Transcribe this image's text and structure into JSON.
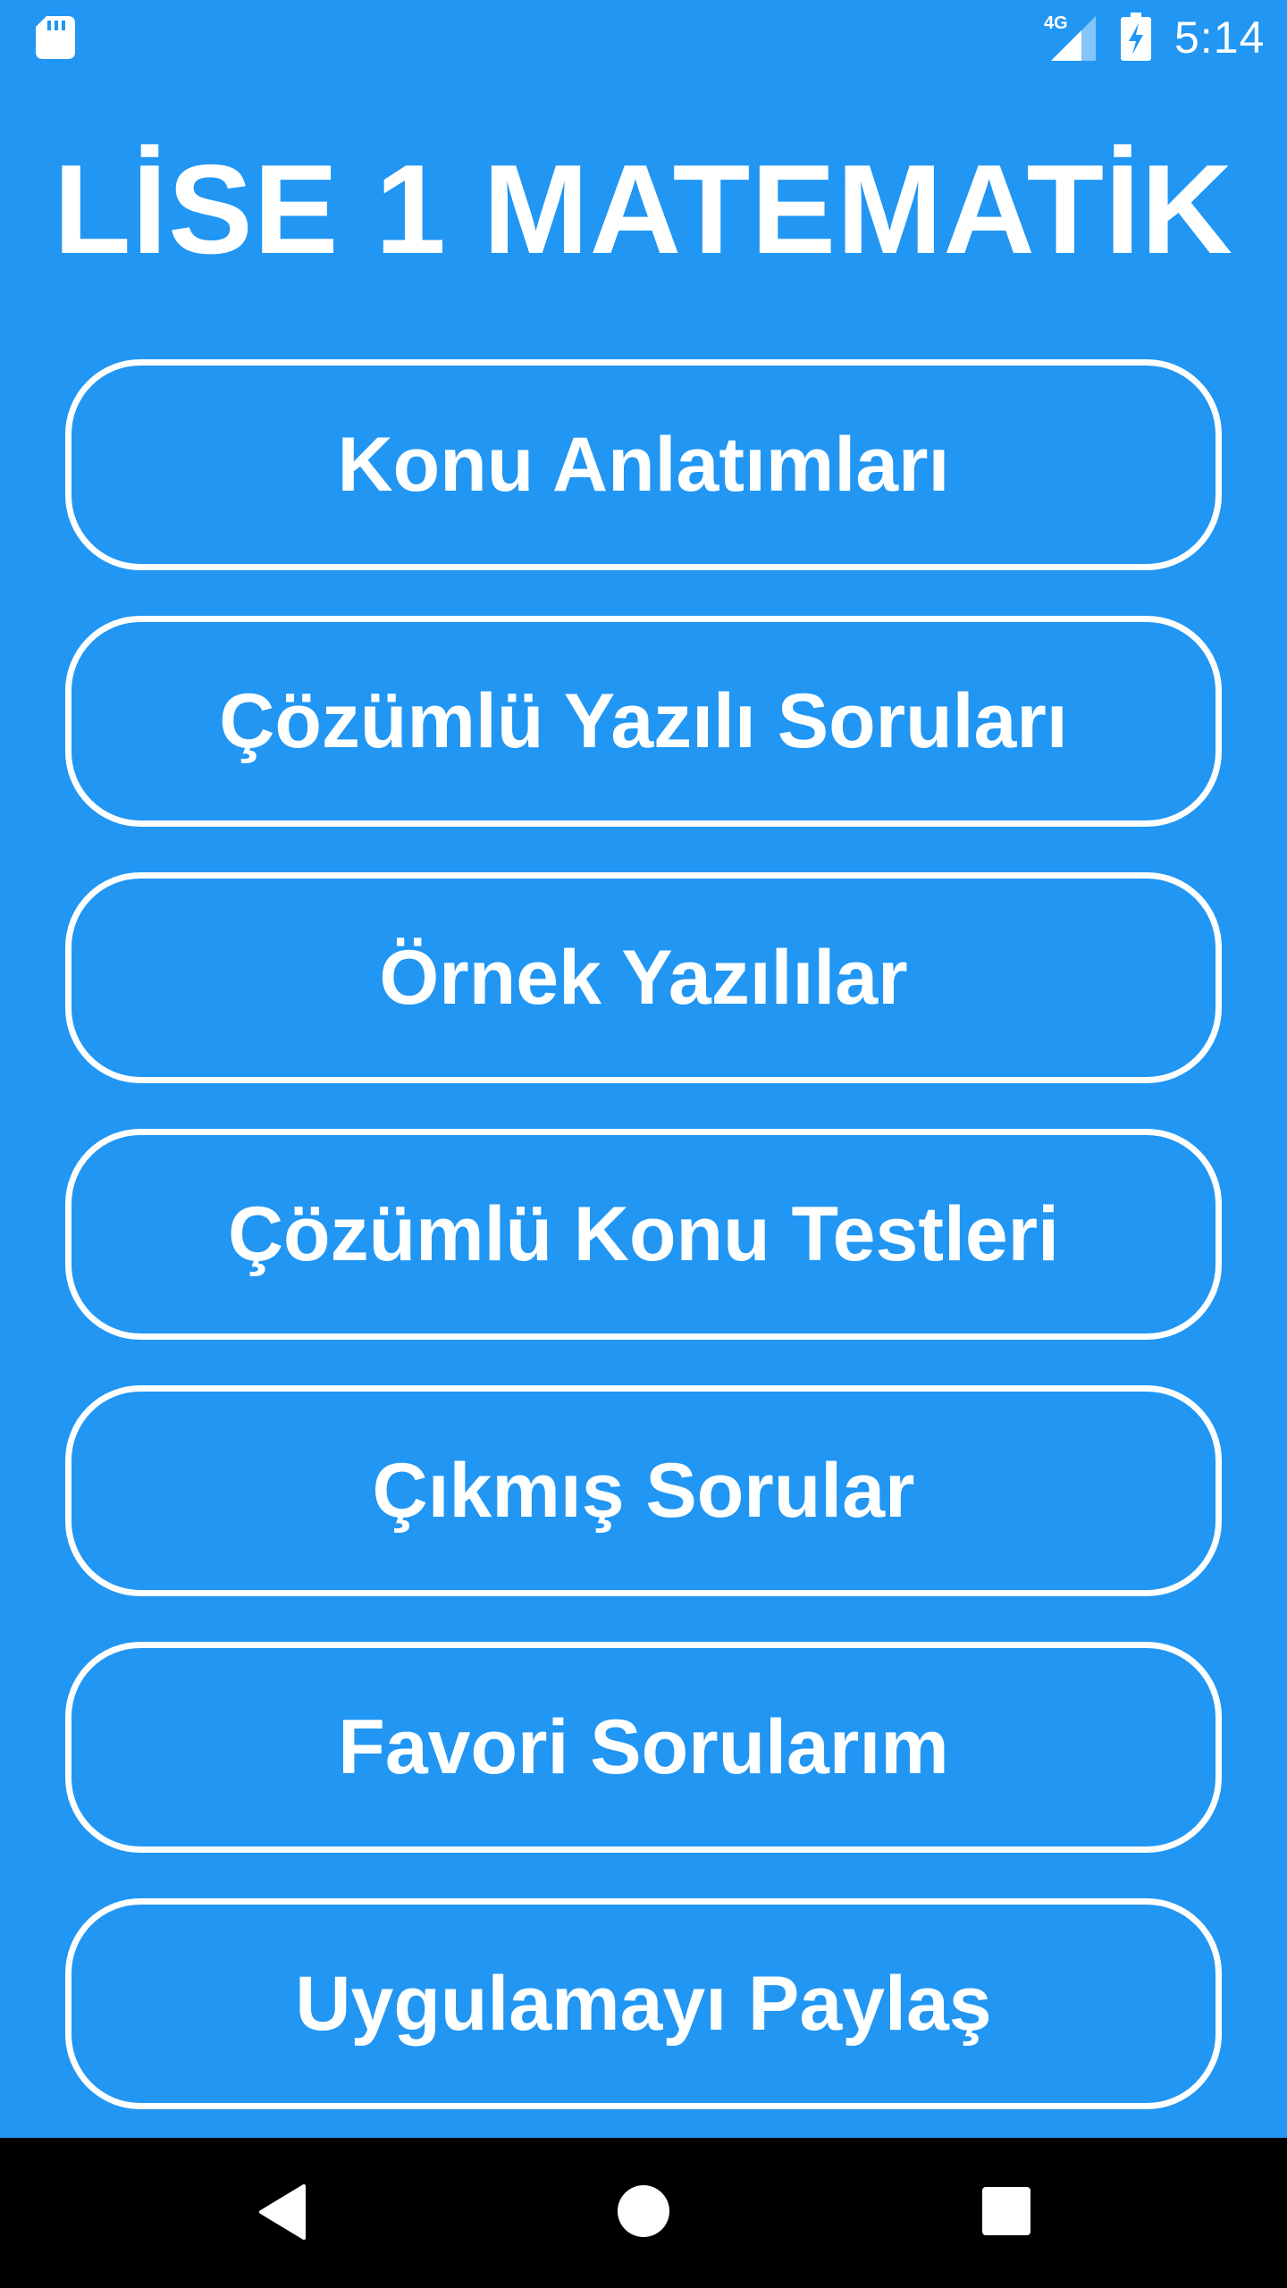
{
  "status_bar": {
    "time": "5:14",
    "network_label": "4G",
    "icons": [
      "sd-card-icon",
      "signal-4g-icon",
      "battery-charging-icon"
    ]
  },
  "header": {
    "title": "LİSE 1 MATEMATİK"
  },
  "menu": {
    "items": [
      {
        "label": "Konu Anlatımları"
      },
      {
        "label": "Çözümlü Yazılı Soruları"
      },
      {
        "label": "Örnek Yazılılar"
      },
      {
        "label": "Çözümlü Konu Testleri"
      },
      {
        "label": "Çıkmış Sorular"
      },
      {
        "label": "Favori Sorularım"
      },
      {
        "label": "Uygulamayı Paylaş"
      }
    ]
  },
  "nav_bar": {
    "icons": [
      "back-icon",
      "home-icon",
      "recents-icon"
    ]
  },
  "colors": {
    "background": "#2196F3",
    "foreground": "#FFFFFF",
    "nav_bar": "#000000"
  }
}
